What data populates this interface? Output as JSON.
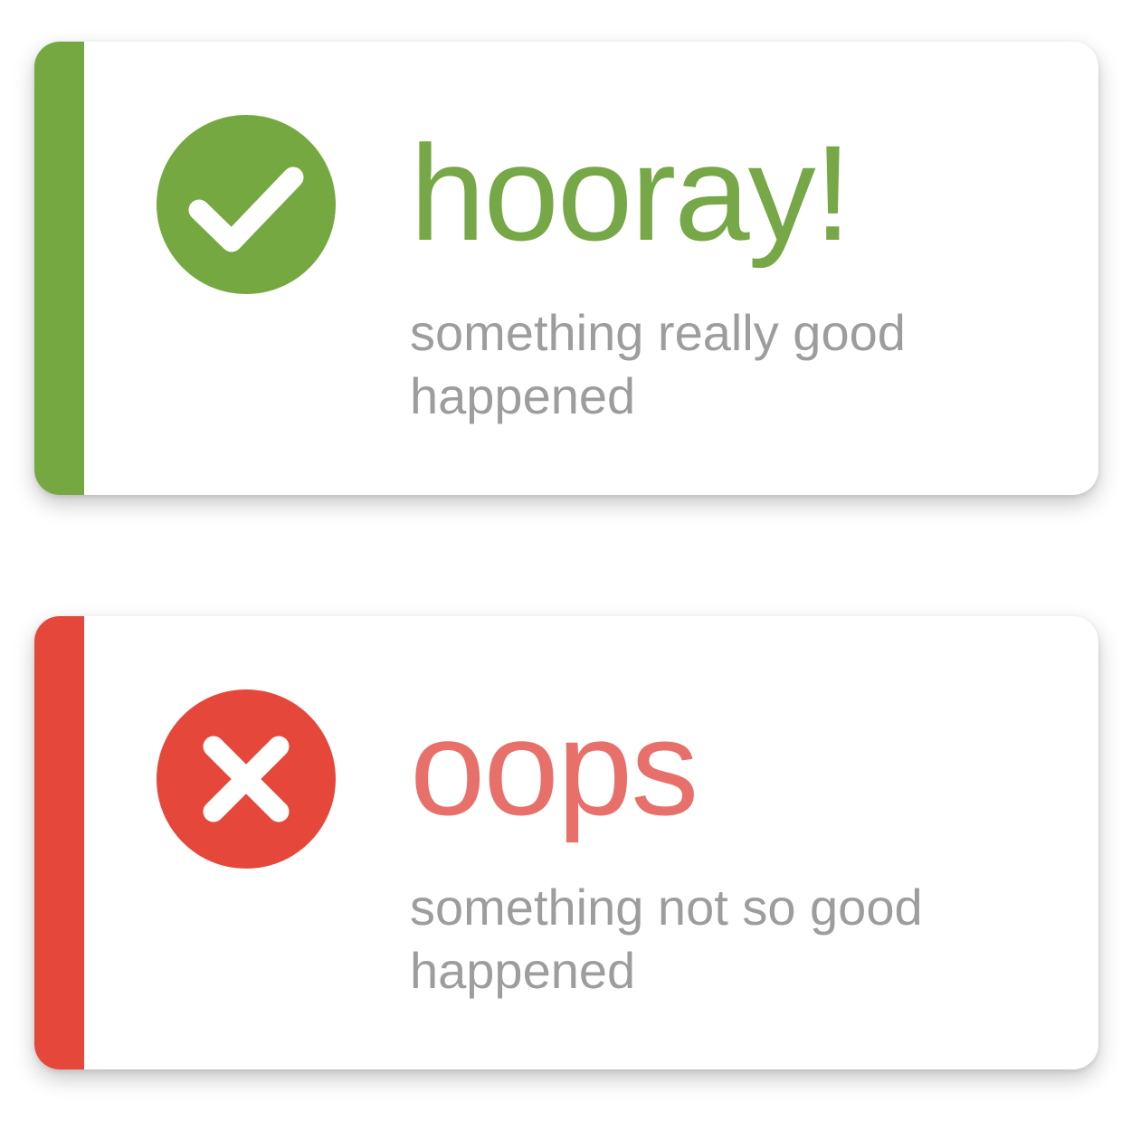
{
  "toasts": [
    {
      "type": "success",
      "title": "hooray!",
      "message": "something really good happened",
      "icon": "check-circle-icon",
      "accent_color": "#76a842",
      "title_color": "#77a847"
    },
    {
      "type": "error",
      "title": "oops",
      "message": "something not so good happened",
      "icon": "x-circle-icon",
      "accent_color": "#e5483b",
      "title_color": "#e8706a"
    }
  ]
}
